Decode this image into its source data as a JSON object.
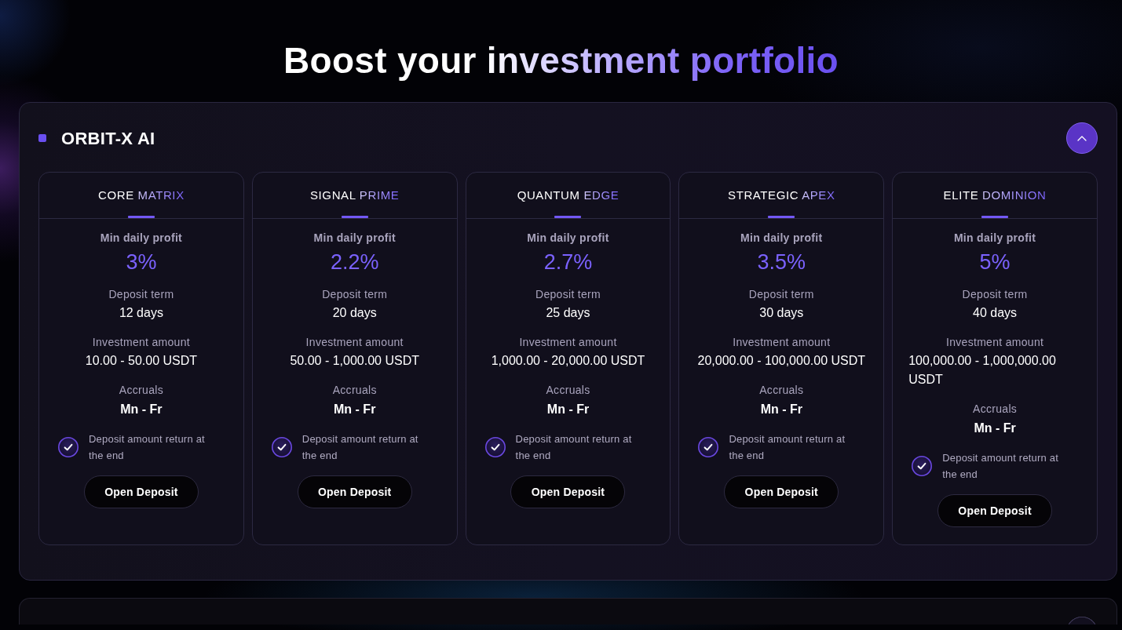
{
  "heading": "Boost your investment portfolio",
  "sections": [
    {
      "title": "ORBIT-X AI",
      "expanded": true,
      "plans": [
        {
          "name": "CORE",
          "name_accent": "MATRIX",
          "fields": [
            {
              "kind": "highlight",
              "label": "Min daily profit",
              "value": "3%"
            },
            {
              "kind": "plain",
              "label": "Deposit term",
              "value": "12 days"
            },
            {
              "kind": "plain",
              "label": "Investment amount",
              "value": "10.00 - 50.00 USDT"
            },
            {
              "kind": "strong",
              "label": "Accruals",
              "value": "Mn - Fr"
            }
          ],
          "feature": {
            "text": "Deposit amount return at the end",
            "checked": true
          },
          "button": "Open Deposit"
        },
        {
          "name": "SIGNAL",
          "name_accent": "PRIME",
          "fields": [
            {
              "kind": "highlight",
              "label": "Min daily profit",
              "value": "2.2%"
            },
            {
              "kind": "plain",
              "label": "Deposit term",
              "value": "20 days"
            },
            {
              "kind": "plain",
              "label": "Investment amount",
              "value": "50.00 - 1,000.00 USDT"
            },
            {
              "kind": "strong",
              "label": "Accruals",
              "value": "Mn - Fr"
            }
          ],
          "feature": {
            "text": "Deposit amount return at the end",
            "checked": true
          },
          "button": "Open Deposit"
        },
        {
          "name": "QUANTUM",
          "name_accent": "EDGE",
          "fields": [
            {
              "kind": "highlight",
              "label": "Min daily profit",
              "value": "2.7%"
            },
            {
              "kind": "plain",
              "label": "Deposit term",
              "value": "25 days"
            },
            {
              "kind": "plain",
              "label": "Investment amount",
              "value": "1,000.00 - 20,000.00 USDT"
            },
            {
              "kind": "strong",
              "label": "Accruals",
              "value": "Mn - Fr"
            }
          ],
          "feature": {
            "text": "Deposit amount return at the end",
            "checked": true
          },
          "button": "Open Deposit"
        },
        {
          "name": "STRATEGIC",
          "name_accent": "APEX",
          "fields": [
            {
              "kind": "highlight",
              "label": "Min daily profit",
              "value": "3.5%"
            },
            {
              "kind": "plain",
              "label": "Deposit term",
              "value": "30 days"
            },
            {
              "kind": "plain",
              "label": "Investment amount",
              "value": "20,000.00 - 100,000.00 USDT"
            },
            {
              "kind": "strong",
              "label": "Accruals",
              "value": "Mn - Fr"
            }
          ],
          "feature": {
            "text": "Deposit amount return at the end",
            "checked": true
          },
          "button": "Open Deposit"
        },
        {
          "name": "ELITE",
          "name_accent": "DOMINION",
          "fields": [
            {
              "kind": "highlight",
              "label": "Min daily profit",
              "value": "5%"
            },
            {
              "kind": "plain",
              "label": "Deposit term",
              "value": "40 days"
            },
            {
              "kind": "plain",
              "label": "Investment amount",
              "value": "100,000.00 - 1,000,000.00 USDT"
            },
            {
              "kind": "strong",
              "label": "Accruals",
              "value": "Mn - Fr"
            }
          ],
          "feature": {
            "text": "Deposit amount return at the end",
            "checked": true
          },
          "button": "Open Deposit"
        }
      ]
    },
    {
      "expanded": false
    }
  ]
}
